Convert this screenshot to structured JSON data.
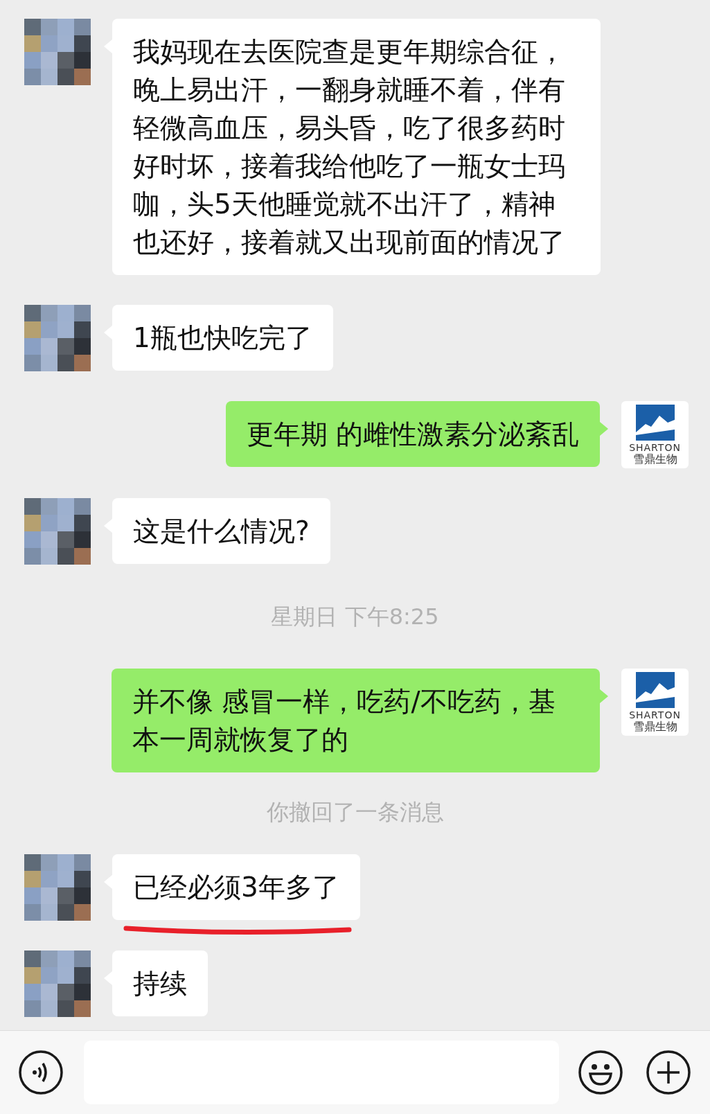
{
  "messages": [
    {
      "kind": "incoming",
      "text": "我妈现在去医院查是更年期综合征，晚上易出汗，一翻身就睡不着，伴有轻微高血压，易头昏，吃了很多药时好时坏，接着我给他吃了一瓶女士玛咖，头5天他睡觉就不出汗了，精神也还好，接着就又出现前面的情况了",
      "underlined": false
    },
    {
      "kind": "incoming",
      "text": "1瓶也快吃完了",
      "underlined": false
    },
    {
      "kind": "outgoing",
      "text": "更年期 的雌性激素分泌紊乱",
      "logo_line1": "SHARTON",
      "logo_line2": "雪鼎生物"
    },
    {
      "kind": "incoming",
      "text": "这是什么情况?",
      "underlined": false
    },
    {
      "kind": "time",
      "text": "星期日 下午8:25"
    },
    {
      "kind": "outgoing",
      "text": "并不像 感冒一样，吃药/不吃药，基本一周就恢复了的",
      "logo_line1": "SHARTON",
      "logo_line2": "雪鼎生物"
    },
    {
      "kind": "system",
      "text": "你撤回了一条消息"
    },
    {
      "kind": "incoming",
      "text": "已经必须3年多了",
      "underlined": true
    },
    {
      "kind": "incoming",
      "text": "持续",
      "underlined": false
    }
  ]
}
